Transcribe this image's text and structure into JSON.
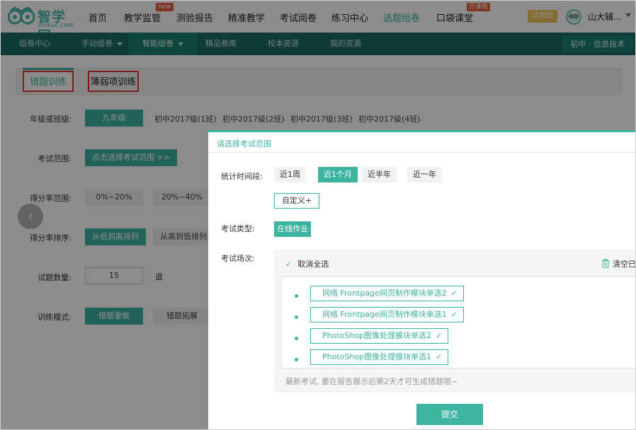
{
  "brand": {
    "name": "智学网",
    "domain": "zhixue.com",
    "color": "#3cb4a0"
  },
  "topnav": {
    "items": [
      {
        "label": "首页"
      },
      {
        "label": "教学监管",
        "badge": "new"
      },
      {
        "label": "测验报告"
      },
      {
        "label": "精准教学"
      },
      {
        "label": "考试阅卷"
      },
      {
        "label": "练习中心"
      },
      {
        "label": "选题组卷"
      },
      {
        "label": "口袋课堂",
        "badge": "开课啦"
      }
    ],
    "trial": "试用版",
    "user": "山大辅..."
  },
  "subnav": {
    "items": [
      "组卷中心",
      "手动组卷",
      "智能组卷",
      "精品卷库",
      "校本资源",
      "我的资源"
    ],
    "subject": "初中 · 信息技术"
  },
  "tabs": {
    "active": "错题训练",
    "other": "薄弱项训练"
  },
  "form": {
    "grade_label": "年级或班级:",
    "grade_options": [
      "九年级",
      "初中2017级(1班)",
      "初中2017级(2班)",
      "初中2017级(3班)",
      "初中2017级(4班)"
    ],
    "exam_label": "考试范围:",
    "exam_button": "点击选择考试范围 >>",
    "score_label": "得分率范围:",
    "score_options": [
      "0%~20%",
      "20%~40%"
    ],
    "sort_label": "得分率排序:",
    "sort_options": [
      "从低到高排列",
      "从高到低排列"
    ],
    "count_label": "试题数量:",
    "count_value": "15",
    "count_unit": "道",
    "mode_label": "训练模式:",
    "mode_options": [
      "错题重做",
      "错题拓展"
    ]
  },
  "modal": {
    "title": "请选择考试范围",
    "time_label": "统计时间段:",
    "time_options": [
      "近1周",
      "近1个月",
      "近半年",
      "近一年"
    ],
    "custom": "自定义+",
    "type_label": "考试类型:",
    "type_option": "在线作业",
    "session_label": "考试场次:",
    "deselect_all": "取消全选",
    "clear_selected": "清空已选",
    "exams": [
      "网络 Frontpage网页制作模块单选2",
      "网络 Frontpage网页制作模块单选1",
      "PhotoShop图像处理模块单选2",
      "PhotoShop图像处理模块单选1"
    ],
    "note": "最新考试, 要在报告展示后第2天才可生成错题哦~",
    "submit": "提交"
  }
}
